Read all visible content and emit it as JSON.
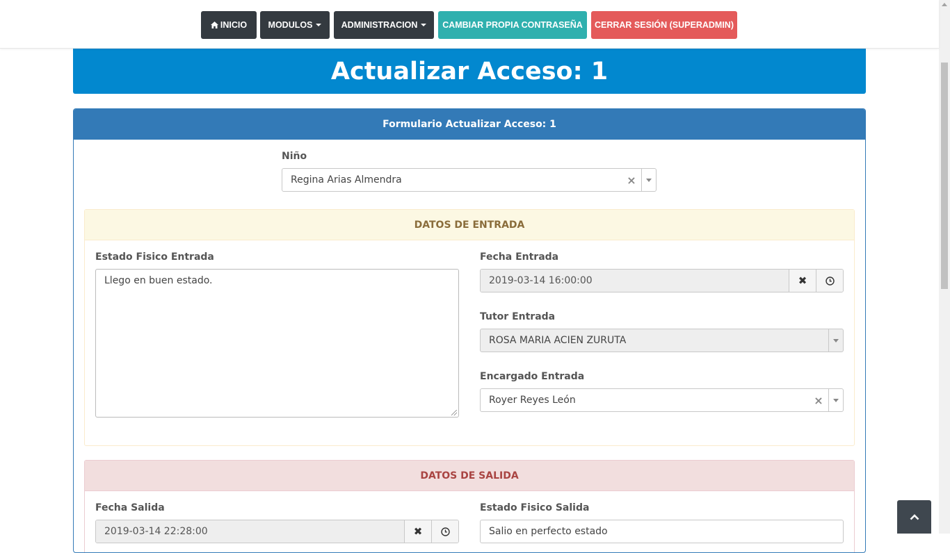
{
  "nav": {
    "inicio": "INICIO",
    "modulos": "MODULOS",
    "administracion": "ADMINISTRACION",
    "cambiar": "CAMBIAR PROPIA CONTRASEÑA",
    "cerrar": "CERRAR SESIÓN (SUPERADMIN)"
  },
  "header": {
    "title": "Actualizar Acceso: 1"
  },
  "panel": {
    "title": "Formulario Actualizar Acceso: 1"
  },
  "nino": {
    "label": "Niño",
    "value": "Regina Arias Almendra"
  },
  "entrada": {
    "title": "DATOS DE ENTRADA",
    "estado_label": "Estado Fisico Entrada",
    "estado_value": "Llego en buen estado.",
    "fecha_label": "Fecha Entrada",
    "fecha_value": "2019-03-14 16:00:00",
    "tutor_label": "Tutor Entrada",
    "tutor_value": "ROSA MARIA ACIEN ZURUTA",
    "encargado_label": "Encargado Entrada",
    "encargado_value": "Royer Reyes León"
  },
  "salida": {
    "title": "DATOS DE SALIDA",
    "fecha_label": "Fecha Salida",
    "fecha_value": "2019-03-14 22:28:00",
    "estado_label": "Estado Fisico Salida",
    "estado_value": "Salio en perfecto estado"
  },
  "icons": {
    "home": "home-icon",
    "clear": "close-icon",
    "clock": "clock-icon",
    "up": "chevron-up-icon"
  },
  "colors": {
    "navbar_dark": "#343a40",
    "teal": "#2fb0ae",
    "red": "#e45a5a",
    "header_blue": "#0288cf",
    "panel_blue": "#337ab7"
  }
}
